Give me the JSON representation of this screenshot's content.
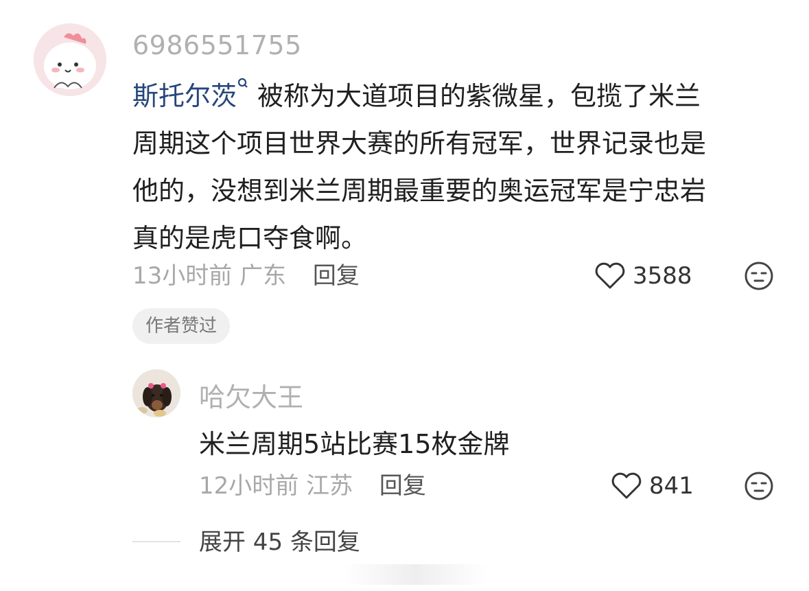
{
  "comment": {
    "username": "6986551755",
    "link_text": "斯托尔茨",
    "lines": [
      "被称为大道项目的紫微星，包揽了米兰",
      "周期这个项目世界大赛的所有冠军，世界记录也是",
      "他的，没想到米兰周期最重要的奥运冠军是宁忠岩",
      "真的是虎口夺食啊。"
    ],
    "time": "13小时前",
    "location": "广东",
    "reply_label": "回复",
    "likes": "3588",
    "author_badge": "作者赞过"
  },
  "reply": {
    "username": "哈欠大王",
    "text": "米兰周期5站比赛15枚金牌",
    "time": "12小时前",
    "location": "江苏",
    "reply_label": "回复",
    "likes": "841"
  },
  "expand_label": "展开 45 条回复",
  "colors": {
    "link": "#25467a",
    "muted": "#b0b0b0",
    "badge_bg": "#f0f0f0"
  },
  "icons": [
    "heart-outline-icon",
    "neutral-face-icon",
    "search-icon"
  ]
}
